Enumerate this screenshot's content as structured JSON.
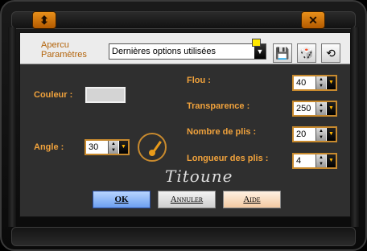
{
  "window": {
    "minimize_glyph": "⬍",
    "close_glyph": "✕"
  },
  "preset": {
    "label_line1": "Apercu",
    "label_line2": "Paramètres",
    "selected": "Dernières options utilisées",
    "icons": [
      "save-icon",
      "random-icon",
      "reset-icon"
    ]
  },
  "fields": {
    "couleur_label": "Couleur :",
    "angle_label": "Angle :",
    "angle_value": "30",
    "flou_label": "Flou :",
    "flou_value": "40",
    "transparence_label": "Transparence :",
    "transparence_value": "250",
    "plis_label": "Nombre de plis :",
    "plis_value": "20",
    "longueur_label": "Longueur des plis :",
    "longueur_value": "4"
  },
  "signature": "Titoune",
  "buttons": {
    "ok": "OK",
    "cancel": "Annuler",
    "help": "Aide"
  },
  "colors": {
    "accent_orange": "#f0a23c",
    "dialog_bg": "#2f2f2f"
  }
}
